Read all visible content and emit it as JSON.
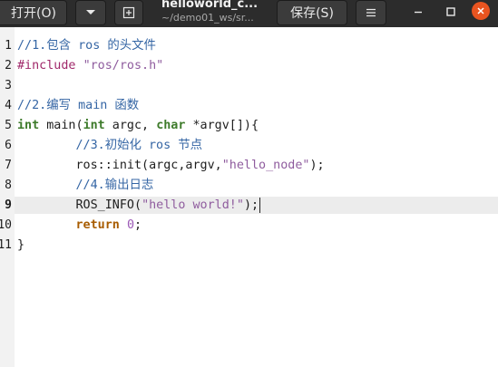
{
  "header": {
    "open_label": "打开(O)",
    "title": "helloworld_c...",
    "subtitle": "~/demo01_ws/sr...",
    "save_label": "保存(S)"
  },
  "icons": {
    "open_menu": "chevron-down-icon",
    "new_tab": "new-tab-icon",
    "menu": "hamburger-menu-icon",
    "minimize": "minimize-icon",
    "maximize": "maximize-icon",
    "close": "close-icon"
  },
  "colors": {
    "header_bg": "#2c2c2c",
    "close_button": "#e95420",
    "comment": "#3465a4",
    "preproc": "#a0286a",
    "string": "#8f5c9e",
    "keyword": "#a85c00",
    "type": "#3e7b2b"
  },
  "editor": {
    "current_line": 9,
    "line_numbers": [
      "1",
      "2",
      "3",
      "4",
      "5",
      "6",
      "7",
      "8",
      "9",
      "10",
      "11"
    ],
    "lines": [
      [
        {
          "t": "//1.包含 ros 的头文件",
          "c": "comment"
        }
      ],
      [
        {
          "t": "#include ",
          "c": "preproc"
        },
        {
          "t": "\"ros/ros.h\"",
          "c": "string"
        }
      ],
      [],
      [
        {
          "t": "//2.编写 main 函数",
          "c": "comment"
        }
      ],
      [
        {
          "t": "int",
          "c": "type"
        },
        {
          "t": " main(",
          "c": "plain"
        },
        {
          "t": "int",
          "c": "type"
        },
        {
          "t": " argc, ",
          "c": "plain"
        },
        {
          "t": "char",
          "c": "type"
        },
        {
          "t": " *argv[]){",
          "c": "plain"
        }
      ],
      [
        {
          "t": "        ",
          "c": "plain"
        },
        {
          "t": "//3.初始化 ros 节点",
          "c": "comment"
        }
      ],
      [
        {
          "t": "        ros::init(argc,argv,",
          "c": "plain"
        },
        {
          "t": "\"hello_node\"",
          "c": "string"
        },
        {
          "t": ");",
          "c": "plain"
        }
      ],
      [
        {
          "t": "        ",
          "c": "plain"
        },
        {
          "t": "//4.输出日志",
          "c": "comment"
        }
      ],
      [
        {
          "t": "        ROS_INFO(",
          "c": "plain"
        },
        {
          "t": "\"hello world!\"",
          "c": "string"
        },
        {
          "t": ");",
          "c": "plain"
        }
      ],
      [
        {
          "t": "        ",
          "c": "plain"
        },
        {
          "t": "return",
          "c": "keyword"
        },
        {
          "t": " ",
          "c": "plain"
        },
        {
          "t": "0",
          "c": "number"
        },
        {
          "t": ";",
          "c": "plain"
        }
      ],
      [
        {
          "t": "}",
          "c": "plain"
        }
      ]
    ]
  }
}
